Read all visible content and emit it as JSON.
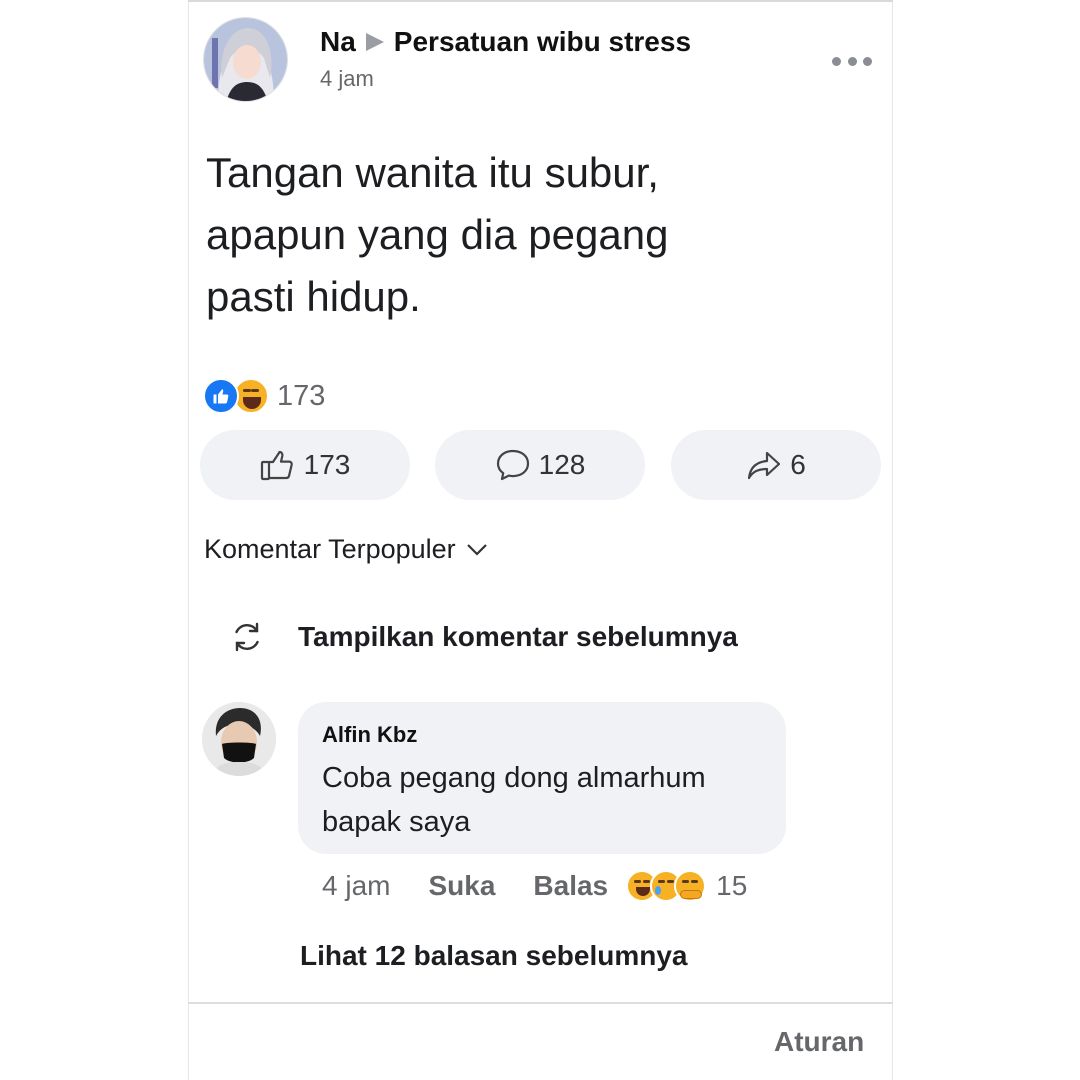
{
  "post": {
    "author": "Na",
    "group": "Persatuan wibu stress",
    "time": "4 jam",
    "text_lines": [
      "Tangan wanita itu subur,",
      "apapun yang dia pegang",
      "pasti hidup."
    ],
    "reaction_icons": [
      "like-icon",
      "haha-icon"
    ],
    "reaction_count": "173",
    "actions": {
      "like_count": "173",
      "comment_count": "128",
      "share_count": "6"
    }
  },
  "comments_section": {
    "sort_label": "Komentar Terpopuler",
    "show_previous": "Tampilkan komentar sebelumnya"
  },
  "comment": {
    "author": "Alfin Kbz",
    "text_lines": [
      "Coba pegang dong almarhum",
      "bapak saya"
    ],
    "time": "4 jam",
    "like_label": "Suka",
    "reply_label": "Balas",
    "reaction_icons": [
      "haha-icon",
      "sad-icon",
      "care-icon"
    ],
    "reaction_count": "15",
    "view_replies": "Lihat 12 balasan sebelumnya"
  },
  "footer": {
    "rules_label": "Aturan"
  },
  "colors": {
    "like_blue": "#1877f2",
    "emoji_yellow": "#f7b125",
    "pill_bg": "#f0f2f5",
    "secondary_text": "#65676b"
  }
}
